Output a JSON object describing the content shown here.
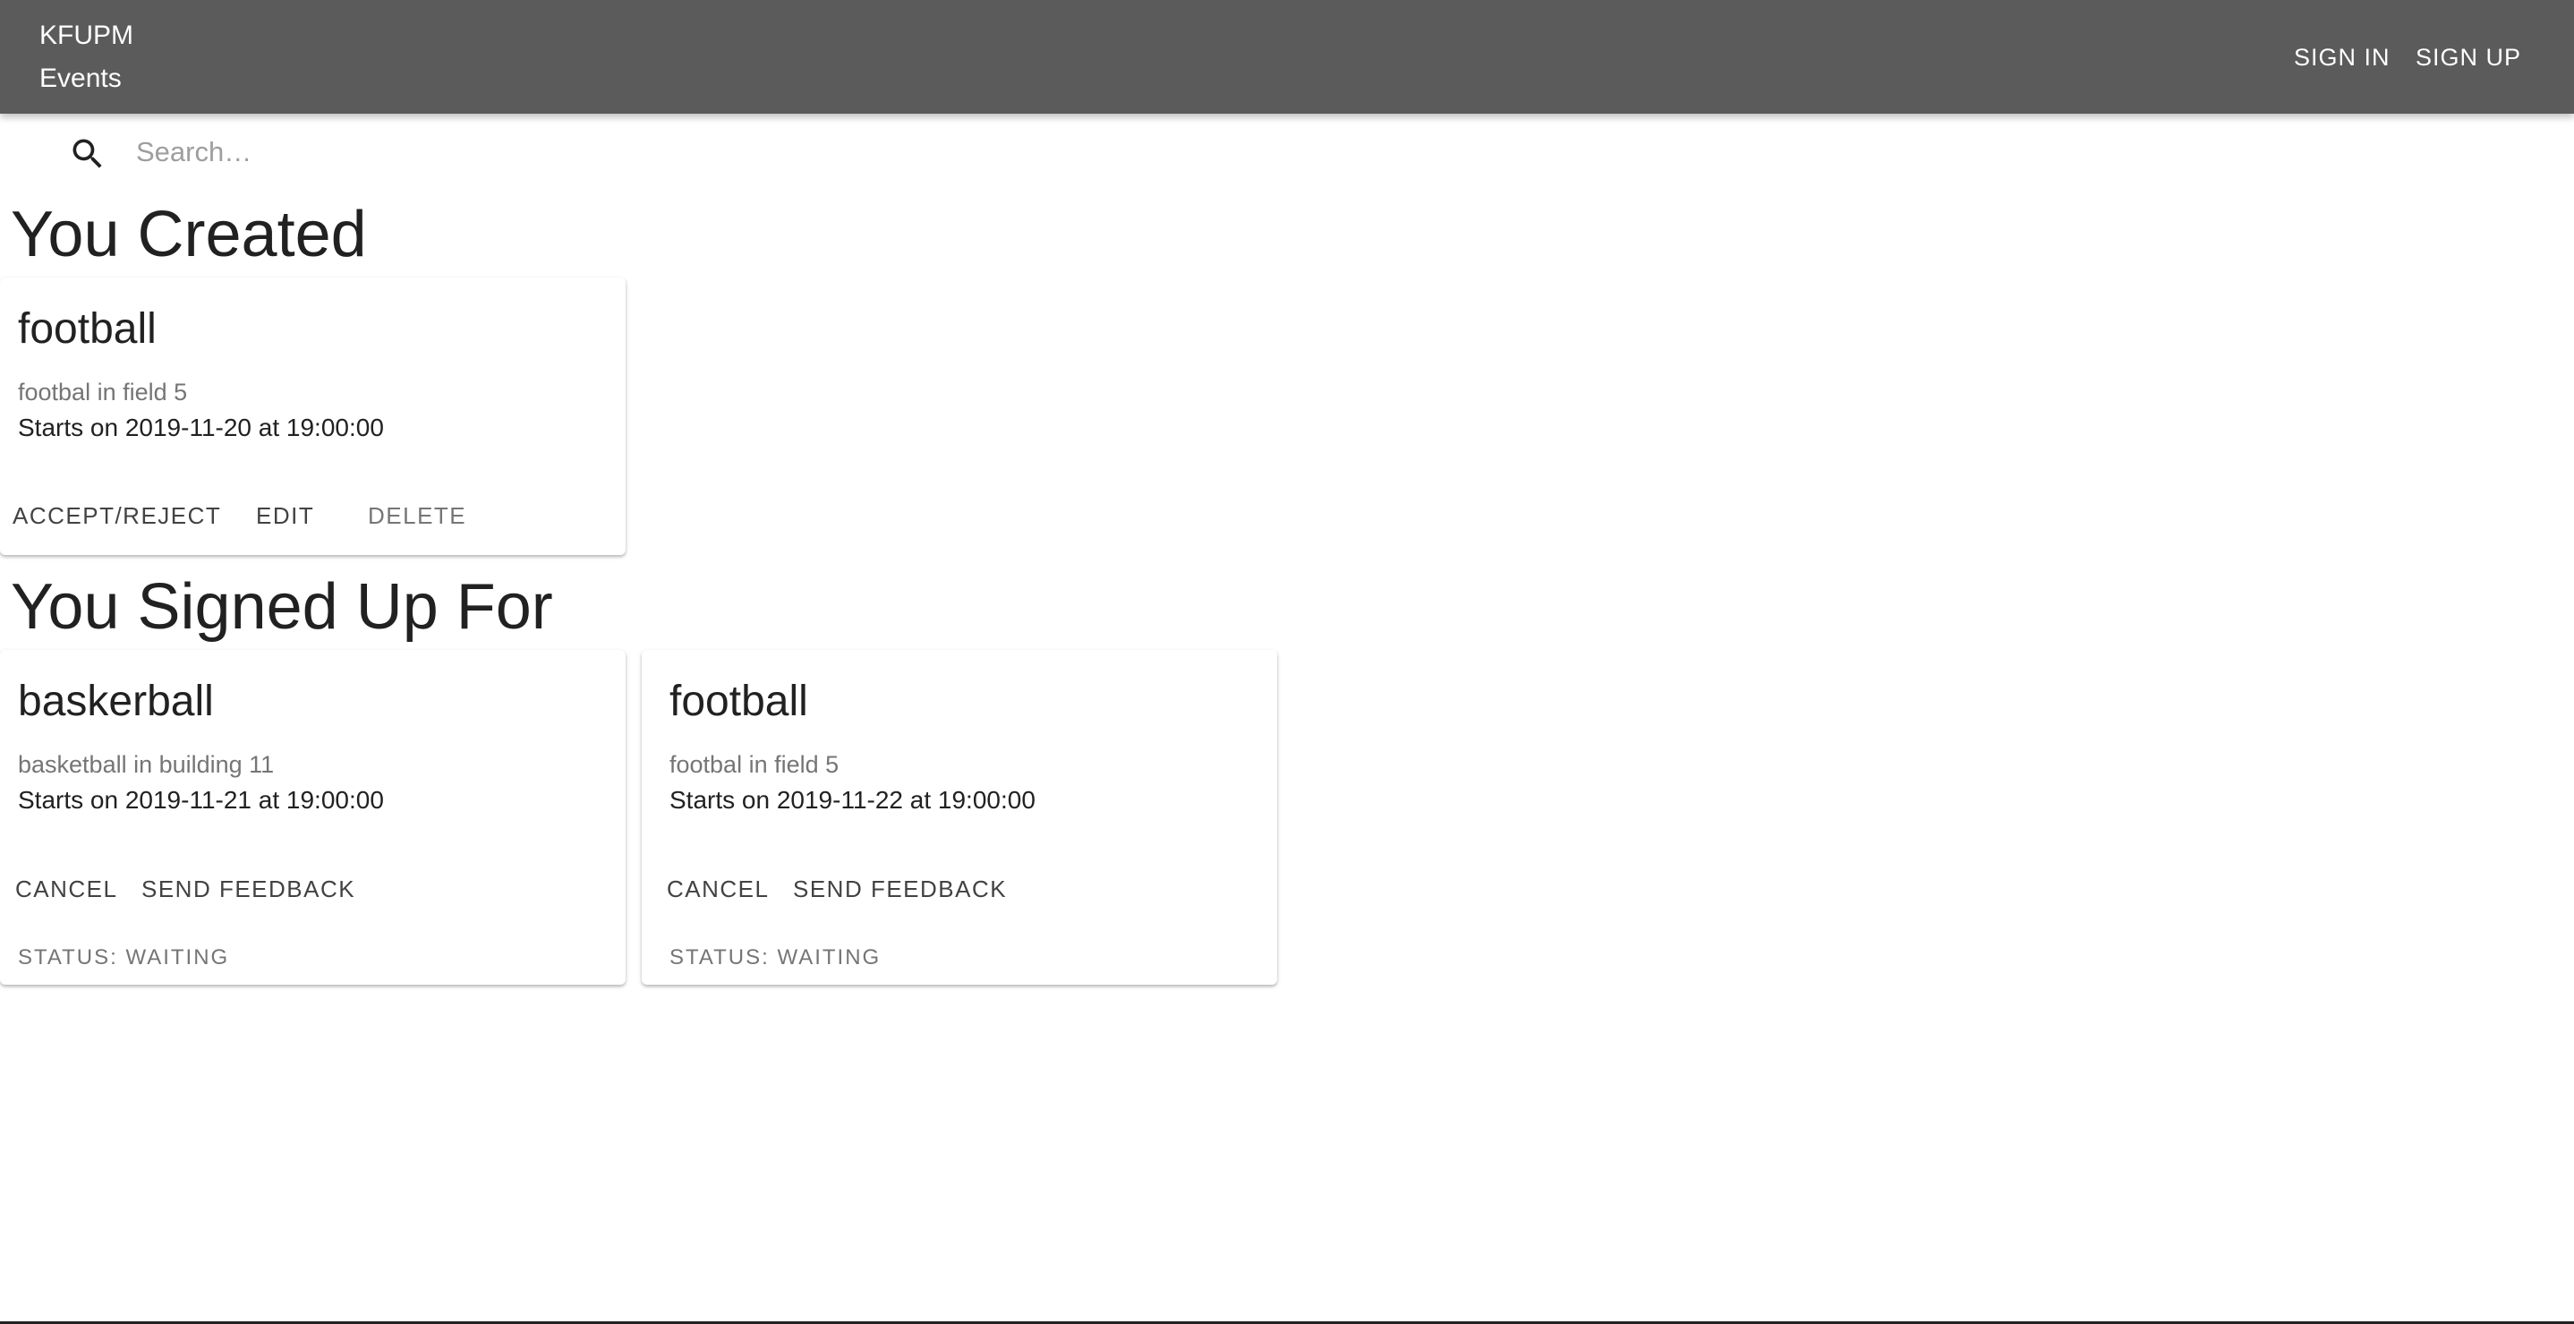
{
  "header": {
    "brand": "KFUPM Events",
    "sign_in": "SIGN IN",
    "sign_up": "SIGN UP",
    "background_color": "#5b5b5b"
  },
  "search": {
    "icon": "search-icon",
    "placeholder": "Search…"
  },
  "created": {
    "title": "You Created",
    "cards": [
      {
        "title": "football",
        "description": "footbal in field 5",
        "date": "Starts on 2019-11-20 at 19:00:00",
        "accept_reject": "ACCEPT/REJECT",
        "edit": "EDIT",
        "delete": "DELETE"
      }
    ]
  },
  "signed_up": {
    "title": "You Signed Up For",
    "cards": [
      {
        "title": "baskerball",
        "description": "basketball in building 11",
        "date": "Starts on 2019-11-21 at 19:00:00",
        "cancel": "CANCEL",
        "feedback": "SEND FEEDBACK",
        "status": "STATUS: WAITING"
      },
      {
        "title": "football",
        "description": "footbal in field 5",
        "date": "Starts on 2019-11-22 at 19:00:00",
        "cancel": "CANCEL",
        "feedback": "SEND FEEDBACK",
        "status": "STATUS: WAITING"
      }
    ]
  }
}
